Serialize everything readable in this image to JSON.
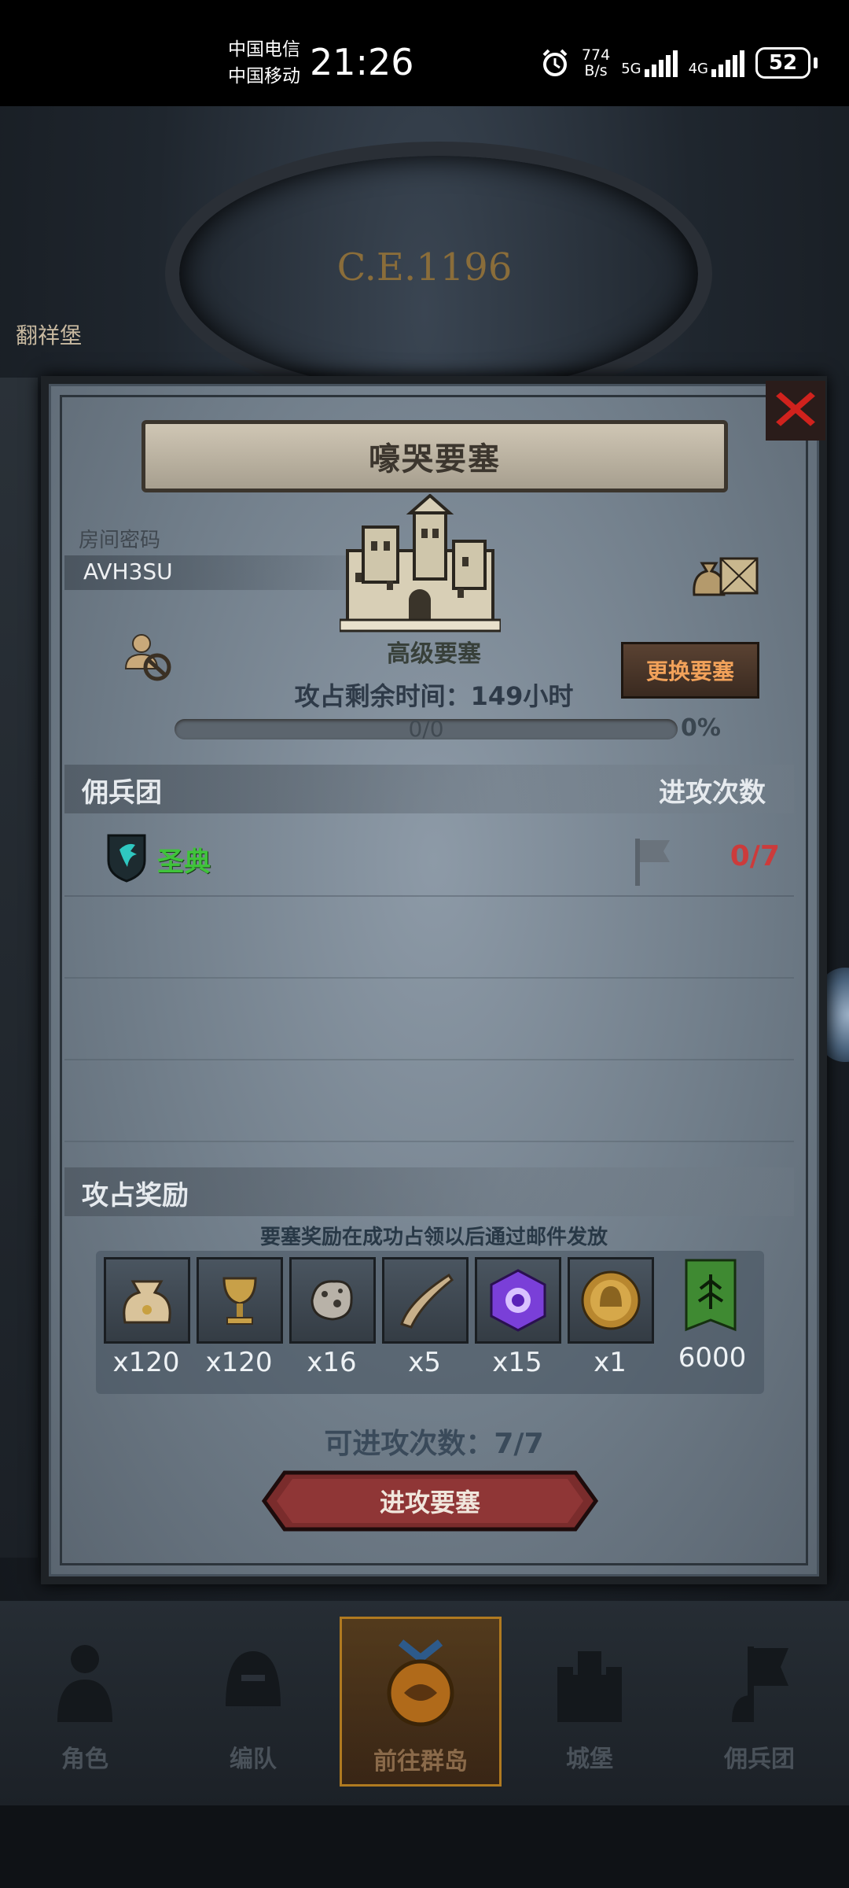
{
  "status_bar": {
    "carrier_1": "中国电信",
    "carrier_2": "中国移动",
    "time": "21:26",
    "net_speed_value": "774",
    "net_speed_unit": "B/s",
    "network_1": "5G",
    "network_2": "4G",
    "battery": "52"
  },
  "background": {
    "era_label": "C.E.1196",
    "left_label": "翻祥堡"
  },
  "modal": {
    "title": "嚎哭要塞",
    "room_password_label": "房间密码",
    "room_password": "AVH3SU",
    "fortress_level": "高级要塞",
    "change_fortress_button": "更换要塞",
    "remaining_time_label": "攻占剩余时间：",
    "remaining_time_value": "149",
    "remaining_time_unit": "小时",
    "progress_text": "0/0",
    "progress_percent": "0%",
    "progress_fraction": 0,
    "mercenary_header": "佣兵团",
    "attack_count_header": "进攻次数",
    "guilds": [
      {
        "name": "圣典",
        "attacks": "0/7"
      }
    ],
    "reward_section_title": "攻占奖励",
    "reward_note": "要塞奖励在成功占领以后通过邮件发放",
    "rewards": [
      {
        "icon": "sack-icon",
        "qty": "x120"
      },
      {
        "icon": "goblet-icon",
        "qty": "x120"
      },
      {
        "icon": "ore-icon",
        "qty": "x16"
      },
      {
        "icon": "horn-icon",
        "qty": "x5"
      },
      {
        "icon": "purple-gem-icon",
        "qty": "x15"
      },
      {
        "icon": "helmet-medal-icon",
        "qty": "x1"
      },
      {
        "icon": "guild-banner-icon",
        "qty": "6000"
      }
    ],
    "attack_available_label": "可进攻次数：",
    "attack_available_value": "7/7",
    "attack_button": "进攻要塞"
  },
  "bottom_nav": [
    {
      "label": "角色",
      "icon": "knight-icon"
    },
    {
      "label": "编队",
      "icon": "helmet-icon"
    },
    {
      "label": "前往群岛",
      "icon": "islands-icon",
      "active": true
    },
    {
      "label": "城堡",
      "icon": "castle-icon"
    },
    {
      "label": "佣兵团",
      "icon": "mercenary-icon"
    }
  ],
  "colors": {
    "guild_name": "#3fc33a",
    "attack_count": "#cc3b3b",
    "change_button_text": "#f2a25a",
    "close_x": "#d0221d",
    "active_nav_border": "#b07a20"
  }
}
